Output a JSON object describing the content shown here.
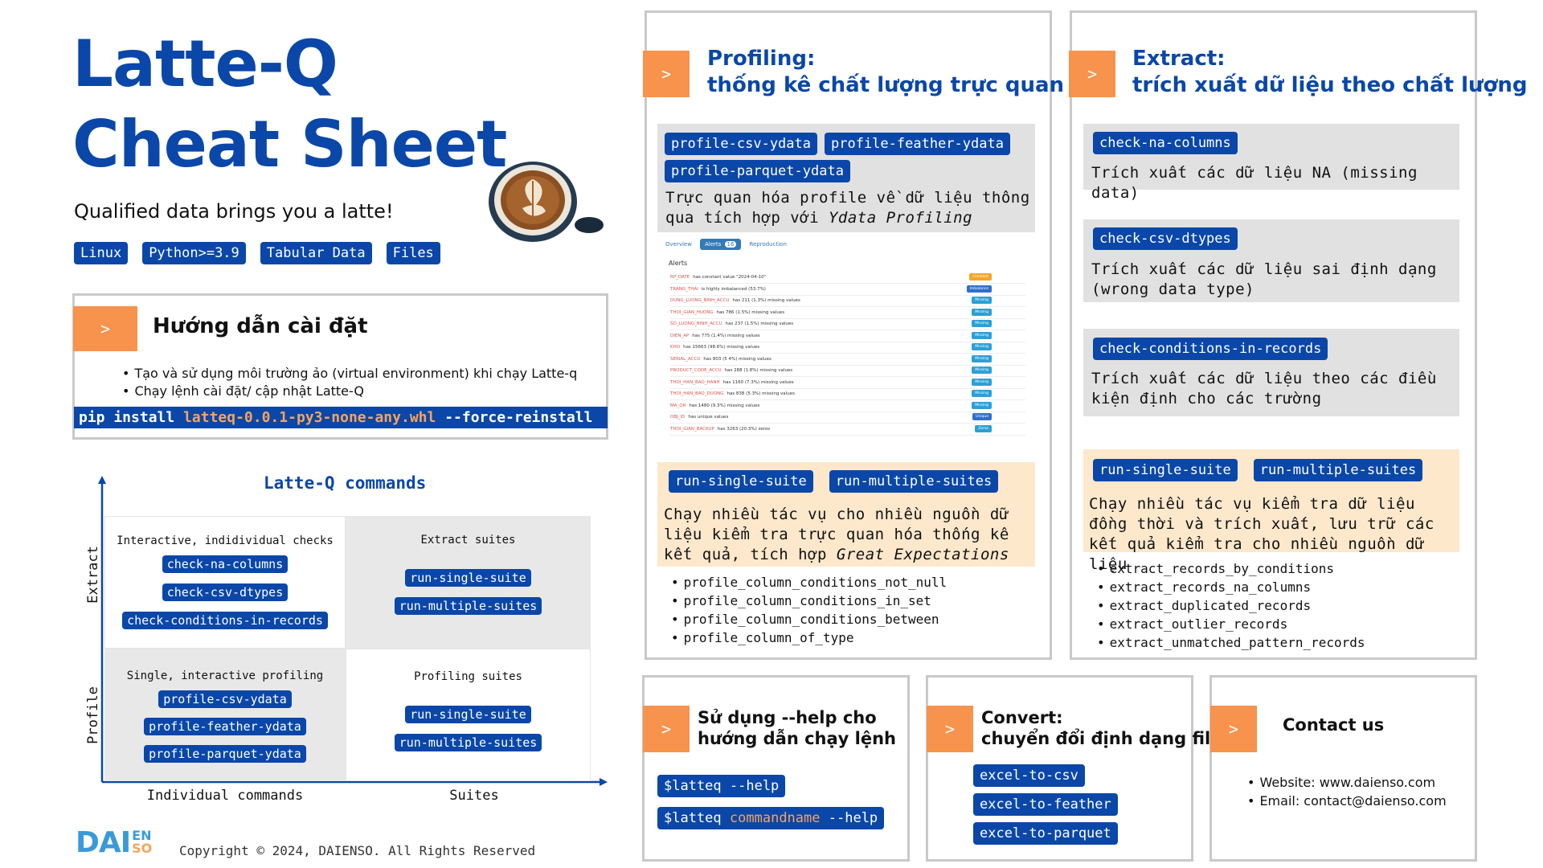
{
  "header": {
    "title_line1": "Latte-Q",
    "title_line2": "Cheat Sheet",
    "tagline": "Qualified data brings you a latte!",
    "badges": [
      "Linux",
      "Python>=3.9",
      "Tabular Data",
      "Files"
    ]
  },
  "install": {
    "chevron": ">",
    "title": "Hướng dẫn cài đặt",
    "bullets": [
      "Tạo và sử dụng môi trường ảo (virtual environment) khi chạy Latte-q",
      "Chạy lệnh cài đặt/ cập nhật Latte-Q"
    ],
    "cmd_prefix": "pip install",
    "cmd_pkg": "latteq-0.0.1-py3-none-any.whl",
    "cmd_suffix": "--force-reinstall"
  },
  "matrix": {
    "title": "Latte-Q commands",
    "y_top": "Extract",
    "y_bottom": "Profile",
    "x_left": "Individual commands",
    "x_right": "Suites",
    "q1": {
      "title": "Interactive, indidividual checks",
      "tags": [
        "check-na-columns",
        "check-csv-dtypes",
        "check-conditions-in-records"
      ]
    },
    "q2": {
      "title": "Extract suites",
      "tags": [
        "run-single-suite",
        "run-multiple-suites"
      ]
    },
    "q3": {
      "title": "Single, interactive profiling",
      "tags": [
        "profile-csv-ydata",
        "profile-feather-ydata",
        "profile-parquet-ydata"
      ]
    },
    "q4": {
      "title": "Profiling suites",
      "tags": [
        "run-single-suite",
        "run-multiple-suites"
      ]
    }
  },
  "footer": {
    "logo_main": "DAI",
    "logo_en": "EN",
    "logo_so": "SO",
    "copyright": "Copyright © 2024, DAIENSO. All Rights Reserved"
  },
  "profiling": {
    "chevron": ">",
    "title_line1": "Profiling:",
    "title_line2": "thống kê chất lượng trực quan",
    "tags": [
      "profile-csv-ydata",
      "profile-feather-ydata",
      "profile-parquet-ydata"
    ],
    "desc_prefix": "Trực quan hóa profile về dữ liệu thông qua tích hợp với ",
    "desc_em": "Ydata Profiling",
    "screenshot": {
      "tabs": [
        "Overview",
        "Alerts",
        "Reproduction"
      ],
      "alerts_count": "16",
      "section": "Alerts",
      "rows": [
        {
          "col": "RP_DATE",
          "text": "has constant value \"2024-04-10\"",
          "badge": "Constant",
          "color": "#f5a623"
        },
        {
          "col": "TRANG_THAI",
          "text": "is highly imbalanced (53.7%)",
          "badge": "Imbalance",
          "color": "#2f6fd1"
        },
        {
          "col": "DUNG_LUONG_BINH_ACCU",
          "text": "has 211 (1.3%) missing values",
          "badge": "Missing",
          "color": "#2c9fd6"
        },
        {
          "col": "THOI_GIAN_HUONG",
          "text": "has 786 (1.5%) missing values",
          "badge": "Missing",
          "color": "#2c9fd6"
        },
        {
          "col": "SO_LUONG_BINH_ACCU",
          "text": "has 237 (1.5%) missing values",
          "badge": "Missing",
          "color": "#2c9fd6"
        },
        {
          "col": "DIEN_AP",
          "text": "has 775 (1.4%) missing values",
          "badge": "Missing",
          "color": "#2c9fd6"
        },
        {
          "col": "KHO",
          "text": "has 15663 (98.6%) missing values",
          "badge": "Missing",
          "color": "#2c9fd6"
        },
        {
          "col": "SERIAL_ACCU",
          "text": "has 803 (5 4%) missing values",
          "badge": "Missing",
          "color": "#2c9fd6"
        },
        {
          "col": "PRODUCT_CODE_ACCU",
          "text": "has 288 (1.8%) missing values",
          "badge": "Missing",
          "color": "#2c9fd6"
        },
        {
          "col": "THOI_HAN_BAO_HANH",
          "text": "has 1160 (7.3%) missing values",
          "badge": "Missing",
          "color": "#2c9fd6"
        },
        {
          "col": "THOI_HAN_BAO_DUONG",
          "text": "has 838 (5.3%) missing values",
          "badge": "Missing",
          "color": "#2c9fd6"
        },
        {
          "col": "MA_QR",
          "text": "has 1480 (9.3%) missing values",
          "badge": "Missing",
          "color": "#2c9fd6"
        },
        {
          "col": "OBJ_ID",
          "text": "has unique values",
          "badge": "Unique",
          "color": "#2f6fd1"
        },
        {
          "col": "THOI_GIAN_BACKUP",
          "text": "has 3263 (20.3%) zeros",
          "badge": "Zeros",
          "color": "#2c9fd6"
        }
      ]
    },
    "suite_tags": [
      "run-single-suite",
      "run-multiple-suites"
    ],
    "suite_desc_prefix": "Chạy nhiều tác vụ cho nhiều nguồn dữ liệu kiểm tra trực quan hóa thống kê kết quả, tích hợp ",
    "suite_desc_em": "Great Expectations",
    "functions": [
      "profile_column_conditions_not_null",
      "profile_column_conditions_in_set",
      "profile_column_conditions_between",
      "profile_column_of_type"
    ]
  },
  "extract": {
    "chevron": ">",
    "title_line1": "Extract:",
    "title_line2": "trích xuất dữ liệu theo chất lượng",
    "items": [
      {
        "tag": "check-na-columns",
        "desc": "Trích xuất các dữ liệu NA (missing data)"
      },
      {
        "tag": "check-csv-dtypes",
        "desc": "Trích xuất các dữ liệu sai định dạng (wrong data type)"
      },
      {
        "tag": "check-conditions-in-records",
        "desc": "Trích xuất các dữ liệu theo các điều kiện định cho các trường"
      }
    ],
    "suite_tags": [
      "run-single-suite",
      "run-multiple-suites"
    ],
    "suite_desc": "Chạy nhiều tác vụ kiểm tra dữ liệu đồng thời và trích xuất, lưu trữ các kết quả kiểm tra cho nhiều nguồn dữ liệu",
    "functions": [
      "extract_records_by_conditions",
      "extract_records_na_columns",
      "extract_duplicated_records",
      "extract_outlier_records",
      "extract_unmatched_pattern_records"
    ]
  },
  "help": {
    "chevron": ">",
    "title_line1": "Sử dụng --help cho",
    "title_line2": "hướng dẫn chạy lệnh",
    "cmd1": "$latteq --help",
    "cmd2_prefix": "$latteq",
    "cmd2_name": "commandname",
    "cmd2_suffix": "--help"
  },
  "convert": {
    "chevron": ">",
    "title_line1": "Convert:",
    "title_line2": "chuyển đổi định dạng file",
    "tags": [
      "excel-to-csv",
      "excel-to-feather",
      "excel-to-parquet"
    ]
  },
  "contact": {
    "chevron": ">",
    "title": "Contact us",
    "website": "Website: www.daienso.com",
    "email": "Email: contact@daienso.com"
  },
  "colors": {
    "brand_blue": "#0a47a9",
    "accent_orange": "#f7934c",
    "highlight_orange": "#f7a35c",
    "panel_gray": "#e1e1e1",
    "panel_peach": "#fde8cc",
    "border_gray": "#c9c9c9"
  }
}
